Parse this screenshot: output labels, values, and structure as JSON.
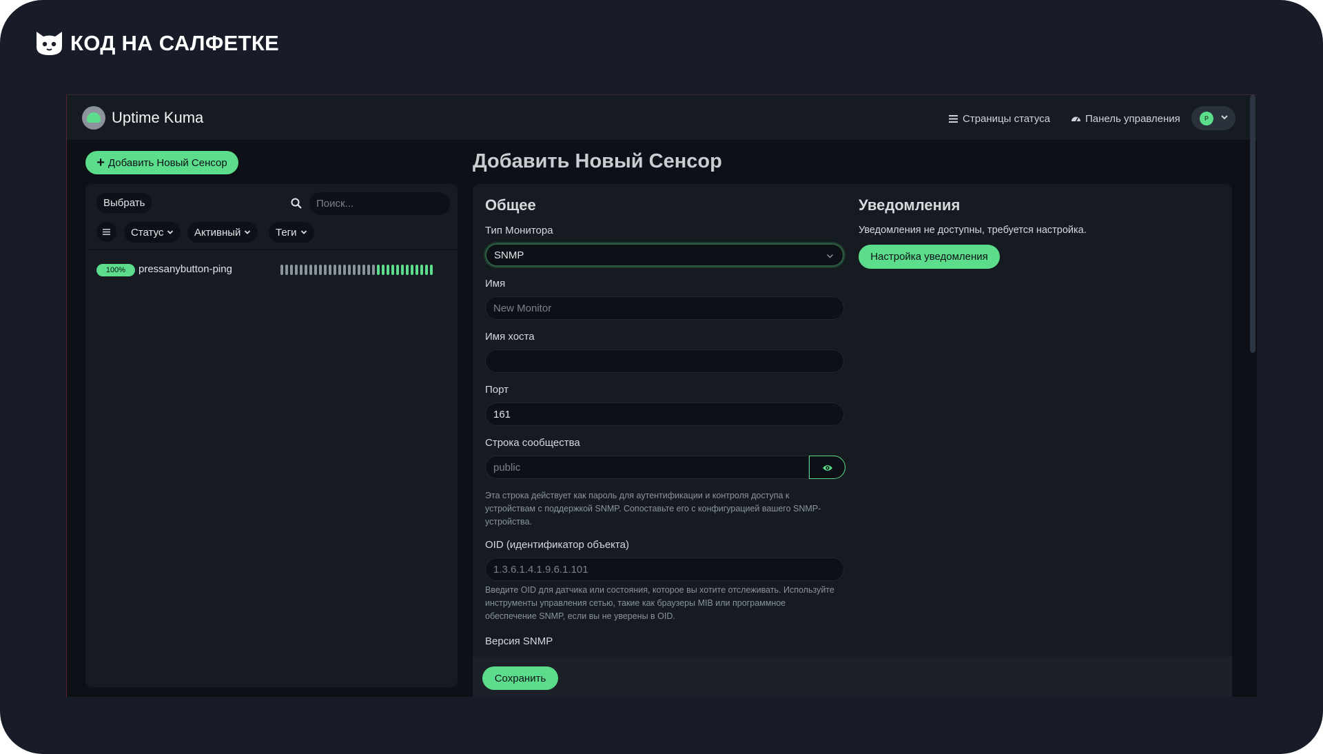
{
  "brand": {
    "text": "КОД НА САЛФЕТКЕ",
    "icon": "cat-logo-icon"
  },
  "app": {
    "title": "Uptime Kuma",
    "nav": {
      "status_pages": "Страницы статуса",
      "dashboard": "Панель управления"
    },
    "profile": {
      "initial": "P"
    }
  },
  "sidebar": {
    "add_button": "Добавить Новый Сенсор",
    "select_button": "Выбрать",
    "search_placeholder": "Поиск...",
    "filters": [
      "Статус",
      "Активный",
      "Теги"
    ],
    "monitors": [
      {
        "uptime": "100%",
        "name": "pressanybutton-ping",
        "beats": [
          "empty",
          "empty",
          "empty",
          "empty",
          "empty",
          "empty",
          "empty",
          "empty",
          "empty",
          "empty",
          "empty",
          "empty",
          "empty",
          "empty",
          "empty",
          "empty",
          "empty",
          "empty",
          "empty",
          "empty",
          "up",
          "up",
          "up",
          "up",
          "up",
          "up",
          "up",
          "up",
          "up",
          "up",
          "up",
          "up"
        ]
      }
    ]
  },
  "page": {
    "title": "Добавить Новый Сенсор",
    "general": {
      "heading": "Общее",
      "monitor_type_label": "Тип Монитора",
      "monitor_type_value": "SNMP",
      "name_label": "Имя",
      "name_placeholder": "New Monitor",
      "hostname_label": "Имя хоста",
      "hostname_value": "",
      "port_label": "Порт",
      "port_value": "161",
      "community_label": "Строка сообщества",
      "community_placeholder": "public",
      "community_help_1": "Эта строка действует как пароль для аутентификации и контроля доступа к",
      "community_help_2": "устройствам с поддержкой SNMP. Сопоставьте его с конфигурацией вашего SNMP-",
      "community_help_3": "устройства.",
      "oid_label": "OID (идентификатор объекта)",
      "oid_placeholder": "1.3.6.1.4.1.9.6.1.101",
      "oid_help_1": "Введите OID для датчика или состояния, которое вы хотите отслеживать. Используйте",
      "oid_help_2": "инструменты управления сетью, такие как браузеры MIB или программное",
      "oid_help_3": "обеспечение SNMP, если вы не уверены в OID.",
      "snmp_version_label": "Версия SNMP"
    },
    "notifications": {
      "heading": "Уведомления",
      "text": "Уведомления не доступны, требуется настройка.",
      "setup_button": "Настройка уведомления"
    },
    "save_button": "Сохранить"
  },
  "colors": {
    "accent": "#5cdd8b",
    "background": "#0d1117",
    "panel": "#161b22",
    "frame": "#171c28",
    "beat_empty": "#8b939c"
  }
}
